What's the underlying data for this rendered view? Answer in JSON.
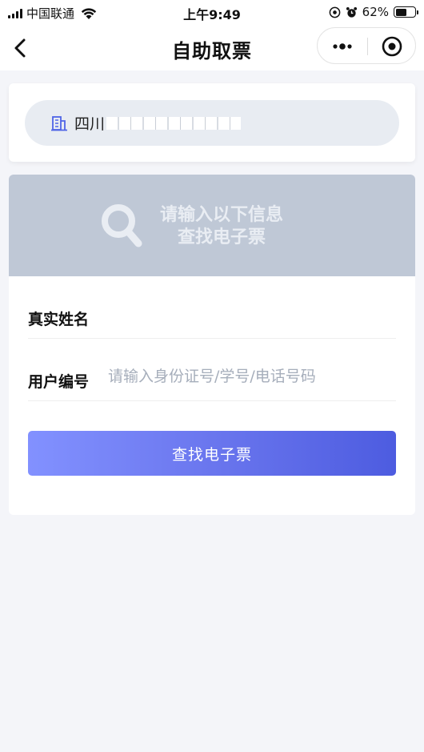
{
  "status_bar": {
    "carrier": "中国联通",
    "time": "上午9:49",
    "battery": "62%",
    "battery_level": 0.62
  },
  "nav": {
    "title": "自助取票"
  },
  "org": {
    "name": "四川"
  },
  "banner": {
    "line1": "请输入以下信息",
    "line2": "查找电子票"
  },
  "form": {
    "name_label": "真实姓名",
    "name_value": "",
    "id_label": "用户编号",
    "id_placeholder": "请输入身份证号/学号/电话号码",
    "submit_label": "查找电子票"
  },
  "colors": {
    "banner_bg": "#bfc8d6",
    "button_gradient_start": "#8291ff",
    "button_gradient_end": "#4d5ce0",
    "page_bg": "#f4f5f9"
  }
}
